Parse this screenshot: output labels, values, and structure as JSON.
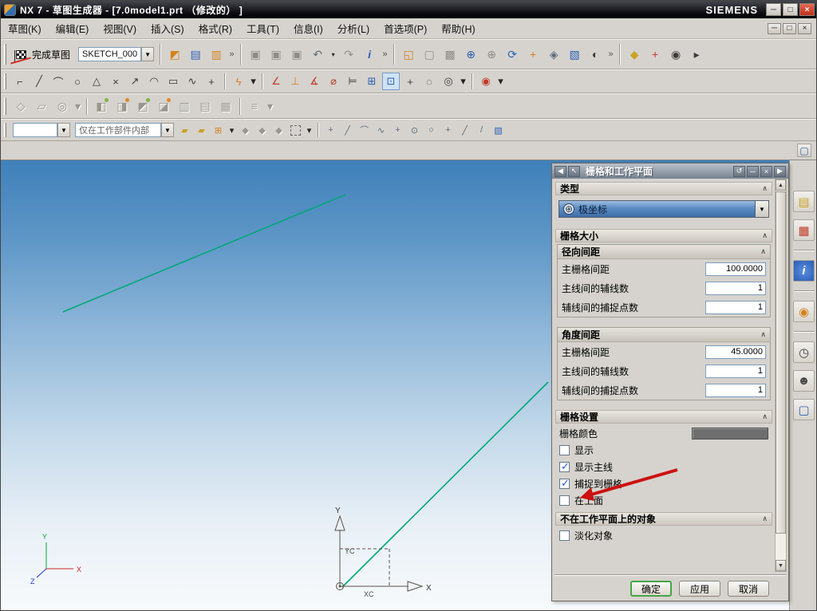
{
  "ui": {
    "chevron": "∧",
    "drop": "▼",
    "scroll_up": "▲",
    "scroll_down": "▼"
  },
  "window": {
    "title": "NX 7 - 草图生成器 - [7.0model1.prt （修改的） ]",
    "brand": "SIEMENS",
    "minimize": "─",
    "maximize": "□",
    "close": "×"
  },
  "menubar": {
    "items": [
      "草图(K)",
      "编辑(E)",
      "视图(V)",
      "插入(S)",
      "格式(R)",
      "工具(T)",
      "信息(I)",
      "分析(L)",
      "首选项(P)",
      "帮助(H)"
    ],
    "mdi_minimize": "─",
    "mdi_restore": "□",
    "mdi_close": "×"
  },
  "standard_toolbar": {
    "finish_label": "完成草图",
    "sketch_name": "SKETCH_000",
    "icons": [
      {
        "n": "sketch-reattach",
        "g": "◩"
      },
      {
        "n": "paste",
        "g": "▤"
      },
      {
        "n": "clipboard",
        "g": "▥"
      },
      {
        "n": "overflow",
        "g": "»"
      },
      {
        "n": "save",
        "g": "▣"
      },
      {
        "n": "save-as",
        "g": "▣"
      },
      {
        "n": "export",
        "g": "▣"
      },
      {
        "n": "undo",
        "g": "↶"
      },
      {
        "n": "undo-drop",
        "g": "▾"
      },
      {
        "n": "redo",
        "g": "↷"
      },
      {
        "n": "info",
        "g": "i"
      },
      {
        "n": "overflow",
        "g": "»"
      },
      {
        "n": "fit-view",
        "g": "◱"
      },
      {
        "n": "zoom-box",
        "g": "▢"
      },
      {
        "n": "scale-view",
        "g": "▩"
      },
      {
        "n": "magnifier",
        "g": "⊕"
      },
      {
        "n": "zoom",
        "g": "⊕"
      },
      {
        "n": "refresh",
        "g": "⟳"
      },
      {
        "n": "pan",
        "g": "+"
      },
      {
        "n": "orient-view",
        "g": "◈"
      },
      {
        "n": "shaded-view",
        "g": "▧"
      },
      {
        "n": "render-style",
        "g": "◐"
      },
      {
        "n": "overflow",
        "g": "»"
      },
      {
        "n": "key",
        "g": "◆"
      },
      {
        "n": "measure",
        "g": "+"
      },
      {
        "n": "preferences",
        "g": "◉"
      },
      {
        "n": "pointer",
        "g": "▸"
      }
    ]
  },
  "sketch_toolbar": {
    "icons": [
      {
        "n": "profile",
        "g": "⌐"
      },
      {
        "n": "line",
        "g": "╱"
      },
      {
        "n": "arc",
        "g": "⌒"
      },
      {
        "n": "circle",
        "g": "○"
      },
      {
        "n": "polygon",
        "g": "△"
      },
      {
        "n": "point",
        "g": "×"
      },
      {
        "n": "quick-extend",
        "g": "↗"
      },
      {
        "n": "fillet",
        "g": "◠"
      },
      {
        "n": "rectangle",
        "g": "▭"
      },
      {
        "n": "studio-spline",
        "g": "∿"
      },
      {
        "n": "offset",
        "g": "+"
      },
      {
        "n": "quick-trim",
        "g": "ϟ"
      },
      {
        "n": "trim-drop",
        "g": "▾"
      },
      {
        "n": "inferred-dimension",
        "g": "∠"
      },
      {
        "n": "constraints",
        "g": "⊥"
      },
      {
        "n": "angle-dimension",
        "g": "∡"
      },
      {
        "n": "diameter-dimension",
        "g": "⌀"
      },
      {
        "n": "show-constraints",
        "g": "⊨"
      },
      {
        "n": "auto-constrain",
        "g": "⊞"
      },
      {
        "n": "continuous-auto-dimension",
        "g": "⊡"
      },
      {
        "n": "snap-point",
        "g": "+"
      },
      {
        "n": "reference",
        "g": "◌"
      },
      {
        "n": "alternate-solution",
        "g": "◎"
      },
      {
        "n": "constraint-drop",
        "g": "▾"
      },
      {
        "n": "sketch-wheel",
        "g": "◉"
      },
      {
        "n": "wheel-drop",
        "g": "▾"
      }
    ]
  },
  "feature_toolbar": {
    "icons": [
      {
        "n": "datum-plane",
        "g": "◇"
      },
      {
        "n": "extrude",
        "g": "▱"
      },
      {
        "n": "hole",
        "g": "◎"
      },
      {
        "n": "feature-drop",
        "g": "▾"
      },
      {
        "n": "unite",
        "g": "◧"
      },
      {
        "n": "subtract",
        "g": "◨"
      },
      {
        "n": "intersect",
        "g": "◩"
      },
      {
        "n": "blend",
        "g": "◪"
      },
      {
        "n": "chamfer",
        "g": "▥"
      },
      {
        "n": "trim-body",
        "g": "▤"
      },
      {
        "n": "pattern",
        "g": "▦"
      },
      {
        "n": "more",
        "g": "≡"
      },
      {
        "n": "more-drop",
        "g": "▾"
      }
    ]
  },
  "selection_toolbar": {
    "filter_value": "",
    "scope_value": "仅在工作部件内部",
    "icons": [
      {
        "n": "snap-bar-a",
        "g": "▰"
      },
      {
        "n": "snap-bar-b",
        "g": "▰"
      },
      {
        "n": "create-group",
        "g": "⊞"
      },
      {
        "n": "group-drop",
        "g": "▾"
      },
      {
        "n": "gem-a",
        "g": "◆"
      },
      {
        "n": "gem-b",
        "g": "◆"
      },
      {
        "n": "gem-c",
        "g": "◆"
      },
      {
        "n": "marquee",
        "g": ""
      },
      {
        "n": "marquee-drop",
        "g": "▾"
      },
      {
        "n": "snap-point-enable",
        "g": "+"
      },
      {
        "n": "snap-end",
        "g": "╱"
      },
      {
        "n": "snap-mid",
        "g": "⌒"
      },
      {
        "n": "snap-tangent",
        "g": "∿"
      },
      {
        "n": "snap-intersect",
        "g": "+"
      },
      {
        "n": "snap-center",
        "g": "⊙"
      },
      {
        "n": "snap-circle",
        "g": "○"
      },
      {
        "n": "snap-quadrant",
        "g": "+"
      },
      {
        "n": "snap-existing",
        "g": "╱"
      },
      {
        "n": "snap-pen",
        "g": "/"
      },
      {
        "n": "work-cube",
        "g": "▧"
      }
    ]
  },
  "infobar": {
    "icon": "▢"
  },
  "resource_bar": {
    "icons": [
      {
        "n": "assembly-navigator",
        "g": "▤"
      },
      {
        "n": "constraint-navigator",
        "g": "▦"
      },
      {
        "n": "part-navigator",
        "g": "i"
      },
      {
        "n": "reuse-library",
        "g": "◉"
      },
      {
        "n": "history",
        "g": "◷"
      },
      {
        "n": "roles",
        "g": "☻"
      },
      {
        "n": "windows",
        "g": "▢"
      }
    ]
  },
  "dialog": {
    "title": "栅格和工作平面",
    "titlebar": {
      "collapse": "◀",
      "pointer": "↖",
      "reset": "↺",
      "minimize": "─",
      "close": "×",
      "expand": "▶"
    },
    "type": {
      "header": "类型",
      "value": "极坐标",
      "icon_glyph": "⊕"
    },
    "grid_size_header": "栅格大小",
    "radial": {
      "header": "径向间距",
      "rows": [
        {
          "label": "主栅格间距",
          "value": "100.0000"
        },
        {
          "label": "主线间的辅线数",
          "value": "1"
        },
        {
          "label": "辅线间的捕捉点数",
          "value": "1"
        }
      ]
    },
    "angular": {
      "header": "角度间距",
      "rows": [
        {
          "label": "主栅格间距",
          "value": "45.0000"
        },
        {
          "label": "主线间的辅线数",
          "value": "1"
        },
        {
          "label": "辅线间的捕捉点数",
          "value": "1"
        }
      ]
    },
    "settings": {
      "header": "栅格设置",
      "color_label": "栅格颜色",
      "color_value": "#6e6e6e",
      "checks": [
        {
          "label": "显示",
          "checked": false
        },
        {
          "label": "显示主线",
          "checked": true
        },
        {
          "label": "捕捉到栅格",
          "checked": true
        },
        {
          "label": "在上面",
          "checked": false
        }
      ]
    },
    "off_plane": {
      "header": "不在工作平面上的对象",
      "checks": [
        {
          "label": "淡化对象",
          "checked": false
        }
      ]
    },
    "buttons": {
      "ok": "确定",
      "apply": "应用",
      "cancel": "取消"
    }
  },
  "canvas": {
    "axis_y": "Y",
    "axis_x": "X",
    "yc": "YC",
    "xc": "XC",
    "triad": {
      "x": "X",
      "y": "Y",
      "z": "Z"
    },
    "colors": {
      "sketch_line": "#00a878",
      "annotation": "#cc1111",
      "gradient_top": "#3f80ba",
      "gradient_bottom": "#f7fafc"
    }
  }
}
